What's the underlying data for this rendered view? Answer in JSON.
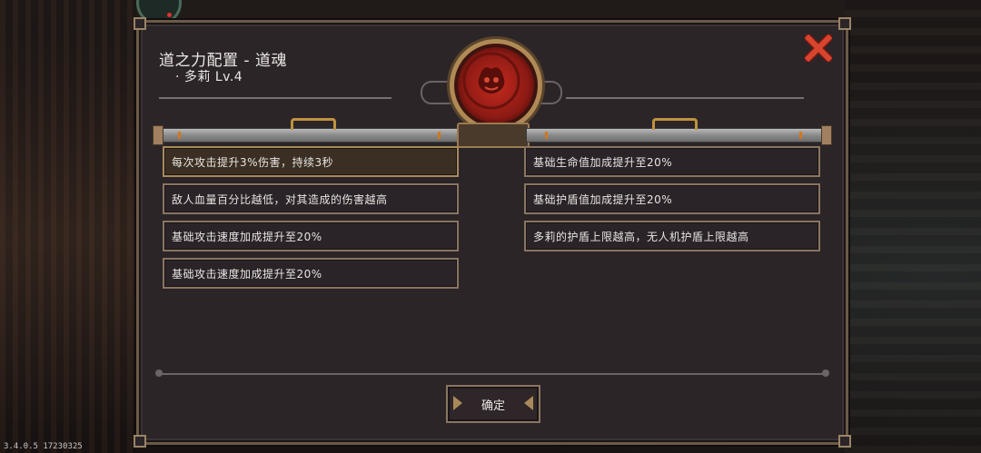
{
  "app": {
    "version": "3.4.0.5 17230325"
  },
  "dialog": {
    "title": "道之力配置 - 道魂",
    "subtitle": "· 多莉 Lv.4",
    "close_icon": "close-x-icon",
    "emblem_icon": "red-spirit-emblem-icon",
    "confirm_label": "确定"
  },
  "left_options": [
    {
      "text": "每次攻击提升3%伤害，持续3秒",
      "selected": true
    },
    {
      "text": "敌人血量百分比越低，对其造成的伤害越高",
      "selected": false
    },
    {
      "text": "基础攻击速度加成提升至20%",
      "selected": false
    },
    {
      "text": "基础攻击速度加成提升至20%",
      "selected": false
    }
  ],
  "right_options": [
    {
      "text": "基础生命值加成提升至20%",
      "selected": false
    },
    {
      "text": "基础护盾值加成提升至20%",
      "selected": false
    },
    {
      "text": "多莉的护盾上限越高，无人机护盾上限越高",
      "selected": false
    }
  ],
  "colors": {
    "panel_bg": "#2b2528",
    "frame": "#8a7560",
    "close_red": "#d8452f",
    "emblem_red": "#c42a1e",
    "selected_bg": "#3a2f22"
  }
}
